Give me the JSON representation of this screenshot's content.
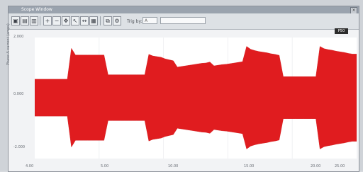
{
  "window": {
    "title": "Scope Window"
  },
  "toolbar": {
    "trigger_label": "Trig by:",
    "trigger_value": "A",
    "channel_placeholder": ""
  },
  "chart_data": {
    "type": "area",
    "title": "",
    "xlabel": "",
    "ylabel": "Phase A current (amps)",
    "x_tick_labels": [
      "4.00",
      "5.00",
      "10.00",
      "15.00",
      "20.00",
      "25.00"
    ],
    "y_tick_labels": [
      "2.000",
      "0.000",
      "-2.000"
    ],
    "badge": "P50",
    "series": [
      {
        "values": [
          0.58,
          0.58,
          0.58,
          0.58,
          0.58,
          0.58,
          0.58,
          0.58,
          0.58,
          1.55,
          1.34,
          1.34,
          1.34,
          1.34,
          1.34,
          1.34,
          1.34,
          1.34,
          0.72,
          0.72,
          0.72,
          0.72,
          0.72,
          0.72,
          0.72,
          0.72,
          0.72,
          0.72,
          1.36,
          1.31,
          1.29,
          1.27,
          1.22,
          1.19,
          1.16,
          0.96,
          0.98,
          1.0,
          1.02,
          1.04,
          1.06,
          1.08,
          1.09,
          1.12,
          1.0,
          1.02,
          1.04,
          1.05,
          1.07,
          1.09,
          1.11,
          1.13,
          1.61,
          1.52,
          1.48,
          1.45,
          1.43,
          1.41,
          1.38,
          1.36,
          1.33,
          0.66,
          0.66,
          0.66,
          0.66,
          0.66,
          0.66,
          0.66,
          0.66,
          0.66,
          1.61,
          1.54,
          1.51,
          1.49,
          1.46,
          1.44,
          1.42,
          1.39,
          1.37,
          1.37
        ]
      }
    ]
  }
}
